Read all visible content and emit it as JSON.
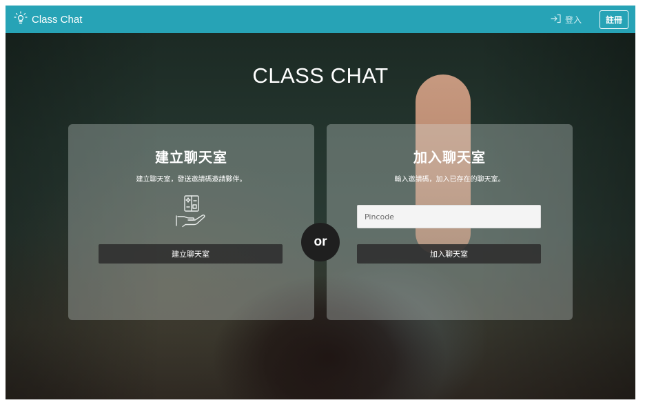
{
  "navbar": {
    "brand_icon": "lightbulb-icon",
    "brand_name": "Class Chat",
    "login_icon": "sign-in-icon",
    "login_label": "登入",
    "register_label": "註冊"
  },
  "hero": {
    "title": "CLASS CHAT",
    "divider_label": "or"
  },
  "create_card": {
    "title": "建立聊天室",
    "subtitle": "建立聊天室，發送邀請碼邀請夥伴。",
    "icon": "hand-card-icon",
    "button_label": "建立聊天室"
  },
  "join_card": {
    "title": "加入聊天室",
    "subtitle": "輸入邀請碼，加入已存在的聊天室。",
    "pincode_placeholder": "Pincode",
    "pincode_value": "",
    "button_label": "加入聊天室"
  },
  "colors": {
    "navbar": "#27a3b6",
    "card_overlay": "rgba(215,225,220,0.32)",
    "button": "#2d2d2d",
    "or_badge": "#1f1f1f"
  }
}
